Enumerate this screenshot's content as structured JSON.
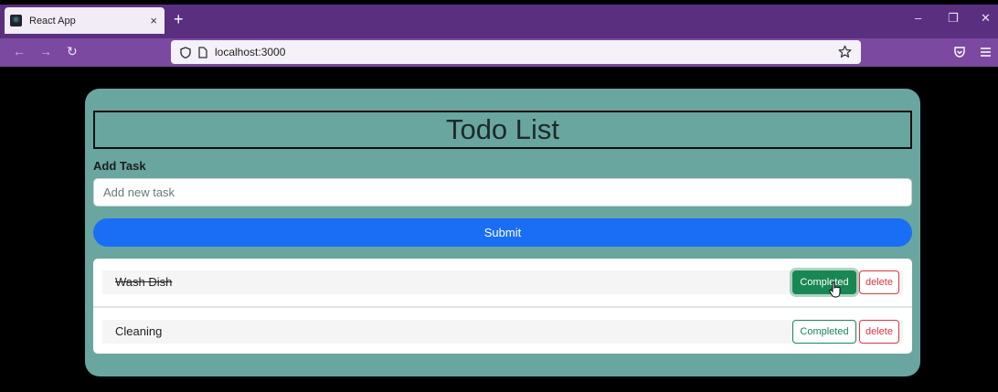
{
  "browser": {
    "tab_title": "React App",
    "tab_favicon": "react-icon",
    "tab_close": "×",
    "new_tab": "+",
    "url": "localhost:3000",
    "controls": {
      "minimize": "–",
      "restore": "❐",
      "close": "✕"
    },
    "nav": {
      "back": "←",
      "forward": "→",
      "reload": "↻"
    }
  },
  "app": {
    "title": "Todo List",
    "add_label": "Add Task",
    "input_placeholder": "Add new task",
    "submit_label": "Submit",
    "tasks": [
      {
        "text": "Wash Dish",
        "completed": true,
        "complete_label": "Completed",
        "delete_label": "delete"
      },
      {
        "text": "Cleaning",
        "completed": false,
        "complete_label": "Completed",
        "delete_label": "delete"
      }
    ]
  },
  "colors": {
    "chrome_tabbar": "#5a2f80",
    "chrome_navbar": "#7b4aa0",
    "card_bg": "#6aa6a0",
    "primary": "#1a6ef5",
    "success": "#198754",
    "danger": "#dc3545"
  }
}
